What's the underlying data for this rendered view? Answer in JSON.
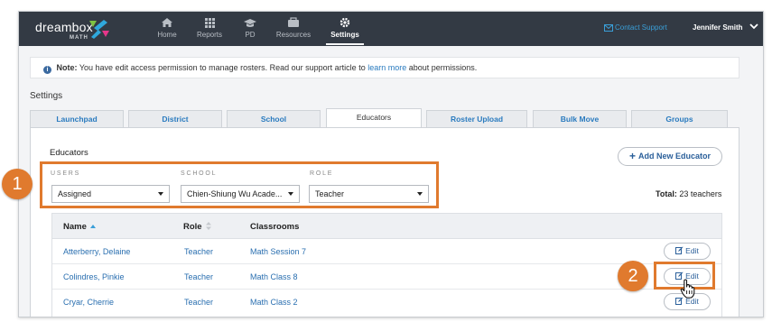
{
  "brand": {
    "word": "dreambox",
    "sub": "MATH"
  },
  "nav": [
    {
      "label": "Home",
      "icon": "home-icon",
      "active": false
    },
    {
      "label": "Reports",
      "icon": "grid-icon",
      "active": false
    },
    {
      "label": "PD",
      "icon": "graduation-cap-icon",
      "active": false
    },
    {
      "label": "Resources",
      "icon": "briefcase-icon",
      "active": false
    },
    {
      "label": "Settings",
      "icon": "gear-icon",
      "active": true
    }
  ],
  "header": {
    "contact": "Contact Support",
    "user": "Jennifer Smith"
  },
  "note": {
    "bold": "Note:",
    "text": "You have edit access permission to manage rosters. Read our support article to",
    "link": "learn more",
    "tail": "about permissions."
  },
  "settings_title": "Settings",
  "tabs": [
    "Launchpad",
    "District",
    "School",
    "Educators",
    "Roster Upload",
    "Bulk Move",
    "Groups"
  ],
  "active_tab": "Educators",
  "panel": {
    "title": "Educators",
    "add_button": "Add New Educator",
    "filters": {
      "users": {
        "label": "USERS",
        "value": "Assigned"
      },
      "school": {
        "label": "SCHOOL",
        "value": "Chien-Shiung Wu Acade..."
      },
      "role": {
        "label": "ROLE",
        "value": "Teacher"
      }
    },
    "total_label": "Total:",
    "total_value": "23 teachers"
  },
  "table": {
    "columns": [
      "Name",
      "Role",
      "Classrooms"
    ],
    "rows": [
      {
        "name": "Atterberry, Delaine",
        "role": "Teacher",
        "classroom": "Math Session 7",
        "edit": "Edit"
      },
      {
        "name": "Colindres, Pinkie",
        "role": "Teacher",
        "classroom": "Math Class 8",
        "edit": "Edit"
      },
      {
        "name": "Cryar, Cherrie",
        "role": "Teacher",
        "classroom": "Math Class 2",
        "edit": "Edit"
      }
    ]
  },
  "callouts": {
    "one": "1",
    "two": "2"
  },
  "colors": {
    "nav_bg": "#333a44",
    "accent": "#e07a2e",
    "link": "#2a7bbf"
  }
}
